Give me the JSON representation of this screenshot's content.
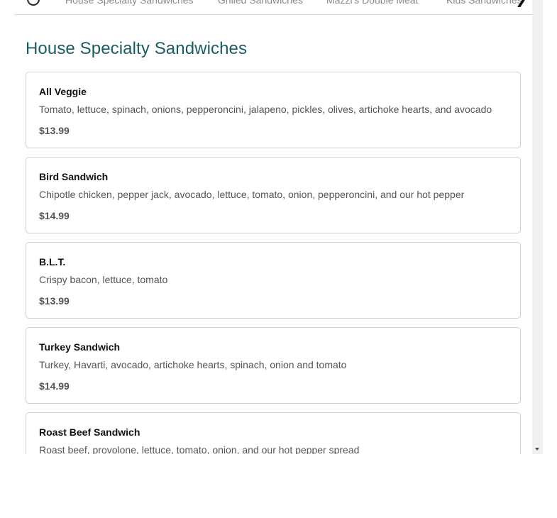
{
  "nav": {
    "tabs": [
      {
        "label": "House Specialty Sandwiches"
      },
      {
        "label": "Grilled Sandwiches"
      },
      {
        "label": "Mazzi's Double Meat"
      },
      {
        "label": "Kids Sandwiches"
      }
    ],
    "back_icon": "circle-back-icon",
    "next_icon": "chevron-right-icon"
  },
  "section": {
    "title": "House Specialty Sandwiches",
    "title_color": "#1a5c63"
  },
  "items": [
    {
      "name": "All Veggie",
      "description": "Tomato, lettuce, spinach, onions, pepperoncini, jalapeno, pickles, olives, artichoke hearts, and avocado",
      "price": "$13.99"
    },
    {
      "name": "Bird Sandwich",
      "description": "Chipotle chicken, pepper jack, avocado, lettuce, tomato, onion, pepperoncini, and our hot pepper",
      "price": "$14.99"
    },
    {
      "name": "B.L.T.",
      "description": "Crispy bacon, lettuce, tomato",
      "price": "$13.99"
    },
    {
      "name": "Turkey Sandwich",
      "description": "Turkey, Havarti, avocado, artichoke hearts, spinach, onion and tomato",
      "price": "$14.99"
    },
    {
      "name": "Roast Beef Sandwich",
      "description": "Roast beef, provolone, lettuce, tomato, onion, and our hot pepper spread",
      "price": ""
    }
  ]
}
